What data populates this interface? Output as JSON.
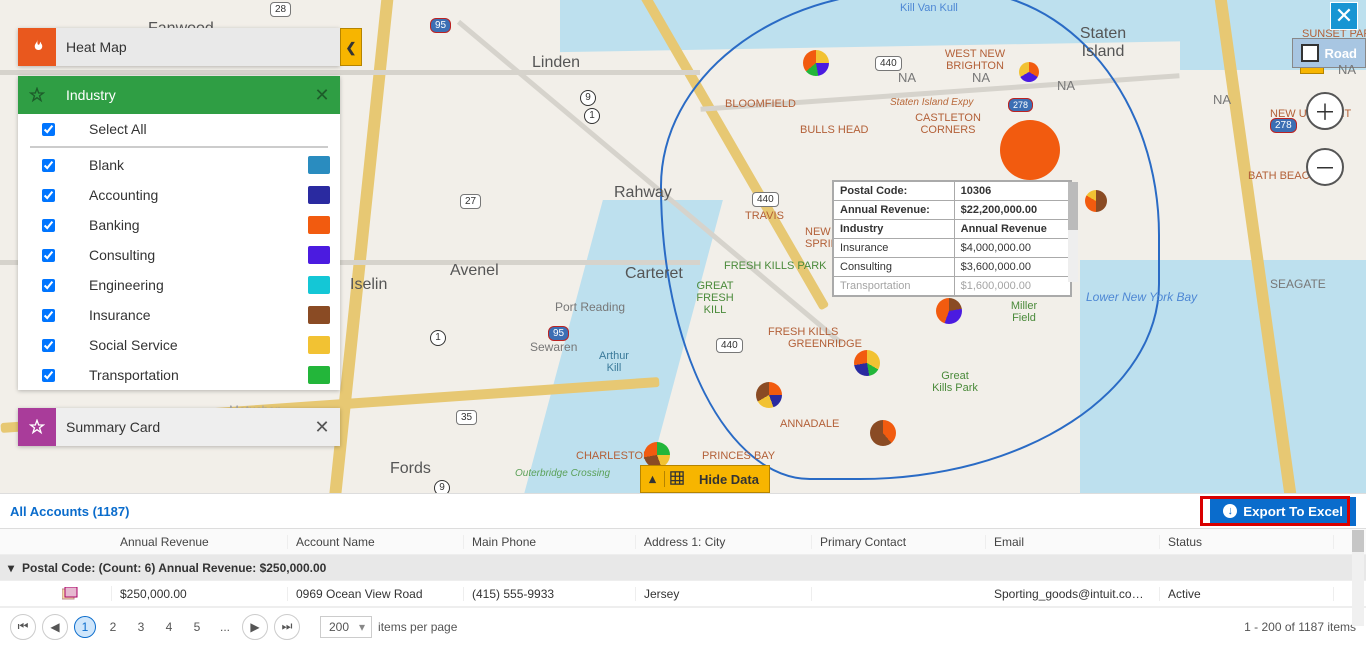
{
  "panels": {
    "heatmap": {
      "title": "Heat Map"
    },
    "industry": {
      "title": "Industry",
      "select_all": "Select All",
      "items": [
        {
          "label": "Blank",
          "color": "#2a8cbf"
        },
        {
          "label": "Accounting",
          "color": "#2a2aa0"
        },
        {
          "label": "Banking",
          "color": "#f25b0f"
        },
        {
          "label": "Consulting",
          "color": "#4b1be0"
        },
        {
          "label": "Engineering",
          "color": "#14c7d6"
        },
        {
          "label": "Insurance",
          "color": "#8a4b24"
        },
        {
          "label": "Social Service",
          "color": "#f2c233"
        },
        {
          "label": "Transportation",
          "color": "#23b63a"
        }
      ]
    },
    "summary": {
      "title": "Summary Card"
    }
  },
  "map": {
    "places_big": [
      "Fanwood",
      "Linden",
      "Rahway",
      "Avenel",
      "Iselin",
      "Carteret",
      "Fords",
      "Staten Island"
    ],
    "places_small": [
      "BLOOMFIELD",
      "BULLS HEAD",
      "WEST NEW BRIGHTON",
      "CASTLETON CORNERS",
      "TRAVIS",
      "FRESH KILLS PARK",
      "NEW SPRINGVILLE",
      "GREAT FRESH KILL",
      "FRESH KILLS",
      "GREENRIDGE",
      "ANNADALE",
      "PRINCES BAY",
      "CHARLESTON",
      "Great Kills Park",
      "Miller Field",
      "Arthur Kill",
      "Sewaren",
      "Port Reading",
      "SUNSET PARK",
      "NEW UTRECHT",
      "BATH BEACH",
      "SEAGATE",
      "Kill Van Kull"
    ],
    "misc": {
      "metuchen": "Metuchen",
      "si_expy": "Staten Island Expy",
      "outerbridge": "Outerbridge Crossing"
    },
    "water_label": "Lower New York Bay",
    "na_labels": [
      "NA",
      "NA",
      "NA",
      "NA",
      "NA"
    ],
    "road_toggle": "Road",
    "shields": {
      "r28": "28",
      "i95a": "95",
      "i95b": "95",
      "r9": "9",
      "r1": "1",
      "r27": "27",
      "r440a": "440",
      "r440b": "440",
      "r440c": "440",
      "r1b": "1",
      "r35": "35",
      "r9b": "9",
      "i278": "278",
      "r278": "278",
      "us1_9": "1-9"
    }
  },
  "popup": {
    "rows": [
      [
        "Postal Code:",
        "10306"
      ],
      [
        "Annual Revenue:",
        "$22,200,000.00"
      ]
    ],
    "sub_header": [
      "Industry",
      "Annual Revenue"
    ],
    "sub_rows": [
      [
        "Insurance",
        "$4,000,000.00"
      ],
      [
        "Consulting",
        "$3,600,000.00"
      ],
      [
        "Transportation",
        "$1,600,000.00"
      ]
    ]
  },
  "hide_data": {
    "label": "Hide Data"
  },
  "data": {
    "link": "All Accounts (1187)",
    "export": "Export To Excel",
    "columns": [
      "Annual Revenue",
      "Account Name",
      "Main Phone",
      "Address 1: City",
      "Primary Contact",
      "Email",
      "Status"
    ],
    "group_line": "Postal Code:  (Count: 6) Annual Revenue: $250,000.00",
    "row": {
      "revenue": "$250,000.00",
      "name": "0969 Ocean View Road",
      "phone": "(415) 555-9933",
      "city": "Jersey",
      "contact": "",
      "email": "Sporting_goods@intuit.co…",
      "status": "Active"
    },
    "pager": {
      "pages": [
        "1",
        "2",
        "3",
        "4",
        "5",
        "..."
      ],
      "page_size": "200",
      "per_page_lbl": "items per page",
      "info": "1 - 200 of 1187 items"
    }
  }
}
